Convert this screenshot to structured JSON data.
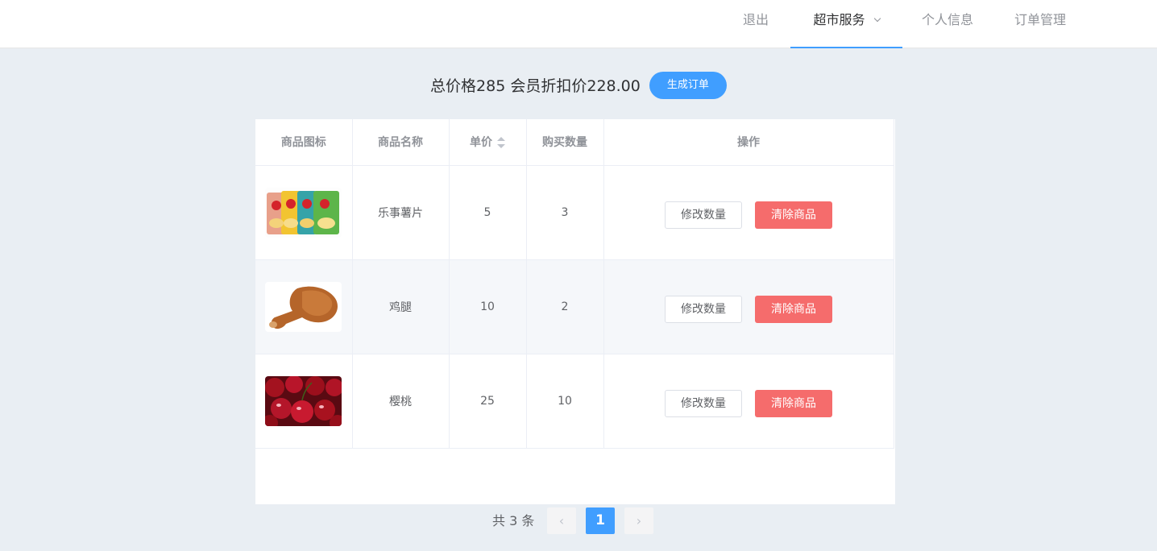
{
  "nav": {
    "logout": "退出",
    "service": "超市服务",
    "profile": "个人信息",
    "orders": "订单管理"
  },
  "summary": {
    "text": "总价格285 会员折扣价228.00",
    "button": "生成订单"
  },
  "table": {
    "headers": [
      "商品图标",
      "商品名称",
      "单价",
      "购买数量",
      "操作"
    ],
    "rows": [
      {
        "icon": "chips-image",
        "name": "乐事薯片",
        "price": "5",
        "qty": "3"
      },
      {
        "icon": "chicken-leg-image",
        "name": "鸡腿",
        "price": "10",
        "qty": "2"
      },
      {
        "icon": "cherry-image",
        "name": "樱桃",
        "price": "25",
        "qty": "10"
      }
    ],
    "edit_label": "修改数量",
    "delete_label": "清除商品"
  },
  "pagination": {
    "total": "共 3 条",
    "current": "1",
    "prev_icon": "chevron-left-icon",
    "next_icon": "chevron-right-icon"
  },
  "colors": {
    "primary": "#409eff",
    "danger": "#f56c6c",
    "background": "#e9eef3"
  }
}
